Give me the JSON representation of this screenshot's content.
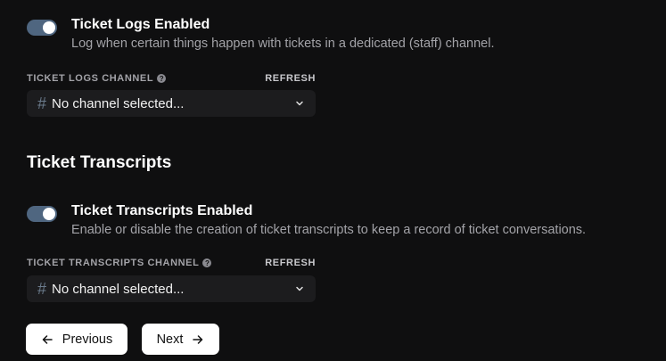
{
  "ticket_logs": {
    "toggle_enabled": true,
    "title": "Ticket Logs Enabled",
    "description": "Log when certain things happen with tickets in a dedicated (staff) channel.",
    "channel_label": "TICKET LOGS CHANNEL",
    "refresh_label": "REFRESH",
    "channel_value": "No channel selected..."
  },
  "transcripts_section": {
    "heading": "Ticket Transcripts"
  },
  "ticket_transcripts": {
    "toggle_enabled": true,
    "title": "Ticket Transcripts Enabled",
    "description": "Enable or disable the creation of ticket transcripts to keep a record of ticket conversations.",
    "channel_label": "TICKET TRANSCRIPTS CHANNEL",
    "refresh_label": "REFRESH",
    "channel_value": "No channel selected..."
  },
  "navigation": {
    "previous_label": "Previous",
    "next_label": "Next"
  },
  "icons": {
    "help": "question-circle-icon",
    "channel": "hash-icon",
    "dropdown": "chevron-down-icon",
    "back": "arrow-left-icon",
    "forward": "arrow-right-icon"
  },
  "colors": {
    "background": "#0f0f10",
    "toggle_on": "#4f6680",
    "input_bg": "#1c1c1e",
    "muted_text": "#a3a3a8"
  }
}
